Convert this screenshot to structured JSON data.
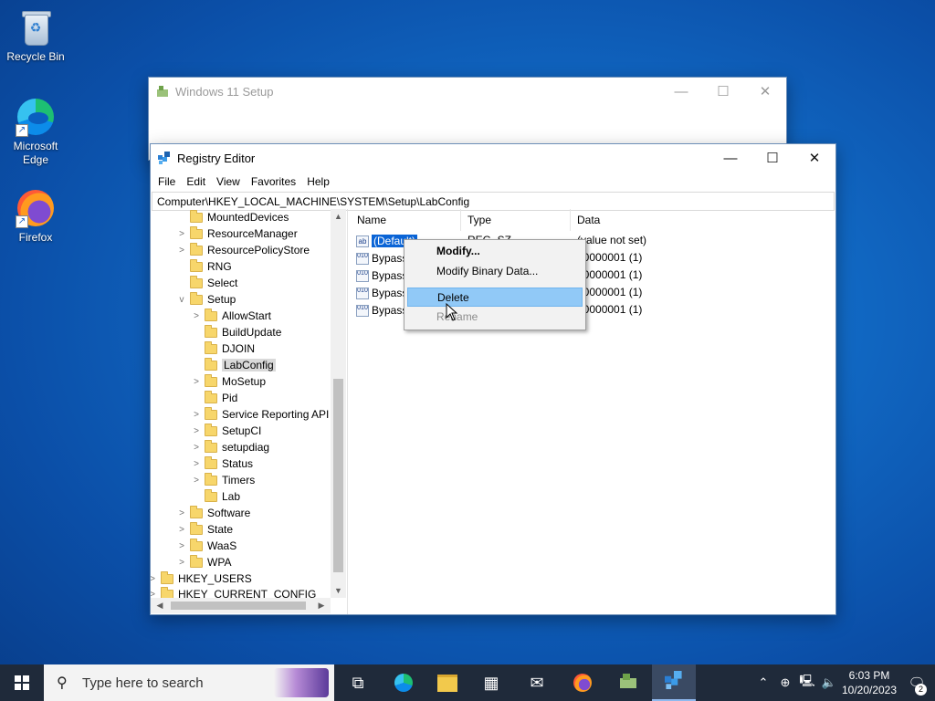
{
  "desktop": {
    "icons": [
      {
        "label": "Recycle Bin"
      },
      {
        "label": "Microsoft Edge"
      },
      {
        "label": "Firefox"
      }
    ]
  },
  "setup_window": {
    "title": "Windows 11 Setup"
  },
  "registry": {
    "title": "Registry Editor",
    "menu": [
      "File",
      "Edit",
      "View",
      "Favorites",
      "Help"
    ],
    "address": "Computer\\HKEY_LOCAL_MACHINE\\SYSTEM\\Setup\\LabConfig",
    "tree": [
      {
        "label": "MountedDevices",
        "chevron": ""
      },
      {
        "label": "ResourceManager",
        "chevron": ">"
      },
      {
        "label": "ResourcePolicyStore",
        "chevron": ">"
      },
      {
        "label": "RNG",
        "chevron": ""
      },
      {
        "label": "Select",
        "chevron": ""
      },
      {
        "label": "Setup",
        "chevron": "v"
      },
      {
        "label": "AllowStart",
        "chevron": ">"
      },
      {
        "label": "BuildUpdate",
        "chevron": ""
      },
      {
        "label": "DJOIN",
        "chevron": ""
      },
      {
        "label": "LabConfig",
        "chevron": ""
      },
      {
        "label": "MoSetup",
        "chevron": ">"
      },
      {
        "label": "Pid",
        "chevron": ""
      },
      {
        "label": "Service Reporting API",
        "chevron": ">"
      },
      {
        "label": "SetupCI",
        "chevron": ">"
      },
      {
        "label": "setupdiag",
        "chevron": ">"
      },
      {
        "label": "Status",
        "chevron": ">"
      },
      {
        "label": "Timers",
        "chevron": ">"
      },
      {
        "label": "Lab",
        "chevron": ""
      },
      {
        "label": "Software",
        "chevron": ">"
      },
      {
        "label": "State",
        "chevron": ">"
      },
      {
        "label": "WaaS",
        "chevron": ">"
      },
      {
        "label": "WPA",
        "chevron": ">"
      },
      {
        "label": "HKEY_USERS",
        "chevron": ">"
      },
      {
        "label": "HKEY_CURRENT_CONFIG",
        "chevron": ">"
      }
    ],
    "columns": {
      "name": "Name",
      "type": "Type",
      "data": "Data"
    },
    "values": [
      {
        "name": "(Default)",
        "type": "REG_SZ",
        "data": "(value not set)",
        "icon": "ab"
      },
      {
        "name": "Bypass",
        "type": "",
        "data": "00000001 (1)",
        "icon": "010"
      },
      {
        "name": "Bypass",
        "type": "",
        "data": "00000001 (1)",
        "icon": "010"
      },
      {
        "name": "Bypass",
        "type": "",
        "data": "00000001 (1)",
        "icon": "010"
      },
      {
        "name": "Bypass",
        "type": "",
        "data": "00000001 (1)",
        "icon": "010"
      }
    ]
  },
  "context_menu": {
    "items": [
      "Modify...",
      "Modify Binary Data...",
      "Delete",
      "Rename"
    ]
  },
  "taskbar": {
    "search_placeholder": "Type here to search",
    "time": "6:03 PM",
    "date": "10/20/2023",
    "notification_count": "2"
  }
}
